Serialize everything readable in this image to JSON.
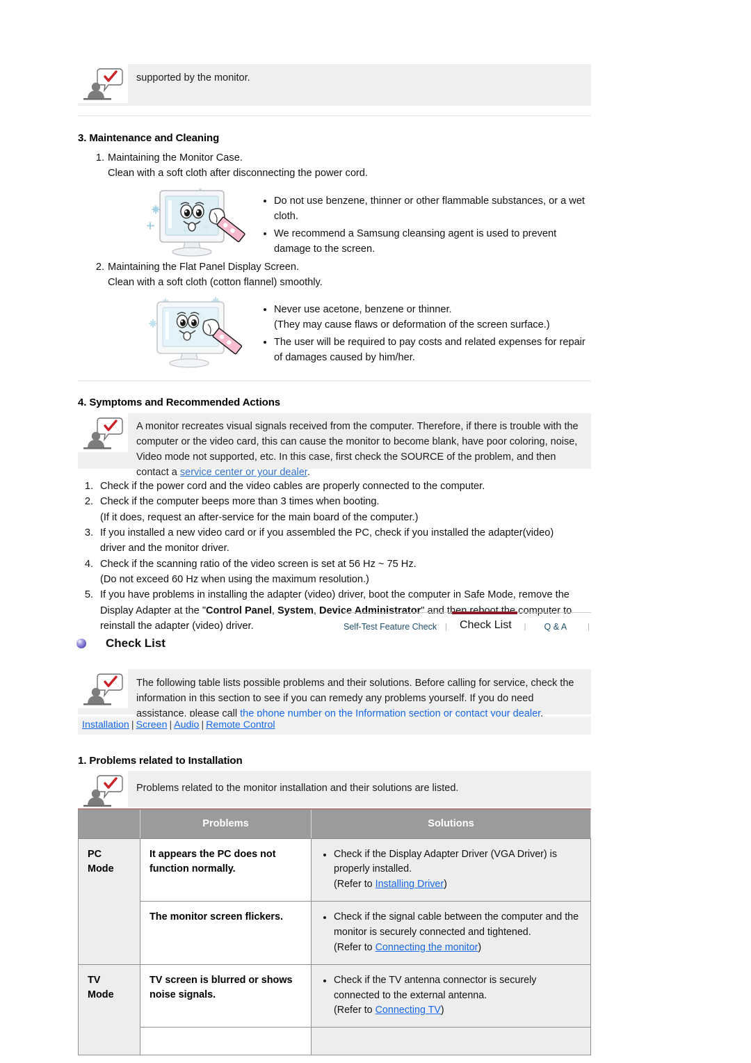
{
  "top_note": {
    "icon": "person-speech-check-icon",
    "text": "supported by the monitor."
  },
  "section3": {
    "heading": "3. Maintenance and Cleaning",
    "items": [
      {
        "num": "1.",
        "line1": "Maintaining the Monitor Case.",
        "line2": "Clean with a soft cloth after disconnecting the power cord."
      },
      {
        "num": "2.",
        "line1": "Maintaining the Flat Panel Display Screen.",
        "line2": "Clean with a soft cloth (cotton flannel) smoothly."
      }
    ],
    "figure1_alt": "cartoon-monitor-being-cleaned-with-cloth",
    "figure2_alt": "cartoon-monitor-being-cleaned-with-cloth",
    "bullets1": [
      "Do not use benzene, thinner or other flammable substances, or a wet cloth.",
      "We recommend a Samsung cleansing agent is used to prevent damage to the screen."
    ],
    "bullets2_line1a": "Never use acetone, benzene or thinner.",
    "bullets2_line1b": "(They may cause flaws or deformation of the screen surface.)",
    "bullets2_line2": "The user will be required to pay costs and related expenses for repair of damages caused by him/her."
  },
  "section4": {
    "heading": "4. Symptoms and Recommended Actions",
    "note_text_1": "A monitor recreates visual signals received from the computer. Therefore, if there is trouble with the computer or the video card, this can cause the monitor to become blank, have poor coloring, noise, Video mode not supported, etc. In this case, first check the SOURCE of the problem, and then contact a ",
    "note_link": "service center or your dealer",
    "note_text_2": ".",
    "steps": [
      {
        "num": "1.",
        "lines": [
          "Check if the power cord and the video cables are properly connected to the computer."
        ]
      },
      {
        "num": "2.",
        "lines": [
          "Check if the computer beeps more than 3 times when booting.",
          "(If it does, request an after-service for the main board of the computer.)"
        ]
      },
      {
        "num": "3.",
        "lines": [
          "If you installed a new video card or if you assembled the PC, check if you installed the adapter(video)",
          "driver and the monitor driver."
        ]
      },
      {
        "num": "4.",
        "lines": [
          "Check if the scanning ratio of the video screen is set at 56 Hz ~ 75 Hz.",
          "(Do not exceed 60 Hz when using the maximum resolution.)"
        ]
      }
    ],
    "step5": {
      "num": "5.",
      "part1": "If you have problems in installing the adapter (video) driver, boot the computer in Safe Mode, remove the Display Adapter at the \"",
      "bold1": "Control Panel",
      "mid1": ", ",
      "bold2": "System",
      "mid2": ", ",
      "bold3": "Device Administrator",
      "part2": "\" and then reboot the computer to reinstall the adapter (video) driver."
    }
  },
  "nav": {
    "tabs": [
      {
        "label": "Self-Test Feature Check",
        "active": false
      },
      {
        "label": "Check List",
        "active": true
      },
      {
        "label": "Q & A",
        "active": false
      }
    ],
    "separator": "|"
  },
  "checklist": {
    "title": "Check List",
    "bullet_icon": "purple-sphere-bullet-icon",
    "note_text_1": "The following table lists possible problems and their solutions. Before calling for service, check the information in this section to see if you can remedy any problems yourself. If you do need assistance, please call ",
    "note_link": "the phone number on the Information section or contact your dealer",
    "note_text_2": ".",
    "crumbs": [
      "Installation",
      "Screen",
      "Audio",
      "Remote Control"
    ],
    "crumb_divider": "|"
  },
  "installation": {
    "heading": "1. Problems related to Installation",
    "note": "Problems related to the monitor installation and their solutions are listed.",
    "table": {
      "headers": [
        "",
        "Problems",
        "Solutions"
      ],
      "rows": [
        {
          "mode": "PC\nMode",
          "mode_line1": "PC",
          "mode_line2": "Mode",
          "problem": "It appears the PC does not function normally.",
          "solution_main": "Check if the Display Adapter Driver (VGA Driver) is properly installed.",
          "solution_refer_pre": "(Refer to ",
          "solution_refer_link": "Installing Driver",
          "solution_refer_post": ")"
        },
        {
          "mode_line1": "",
          "mode_line2": "",
          "problem": "The monitor screen flickers.",
          "solution_main": "Check if the signal cable between the computer and the monitor is securely connected and tightened.",
          "solution_refer_pre": "(Refer to ",
          "solution_refer_link": "Connecting the monitor",
          "solution_refer_post": ")"
        },
        {
          "mode_line1": "TV",
          "mode_line2": "Mode",
          "problem": "TV screen is blurred or shows noise signals.",
          "solution_main": "Check if the TV antenna connector is securely connected to the external antenna.",
          "solution_refer_pre": "(Refer to ",
          "solution_refer_link": "Connecting TV",
          "solution_refer_post": ")"
        },
        {
          "mode_line1": "",
          "mode_line2": "",
          "problem": "",
          "solution_main": "",
          "solution_refer_pre": "",
          "solution_refer_link": "",
          "solution_refer_post": ""
        }
      ]
    }
  },
  "colors": {
    "link": "#1667e8",
    "link_dark": "#2f6fd0",
    "accent_red": "#8d1724",
    "table_header_bg": "#9b9b9b",
    "infobox_bg": "#efefef",
    "row_alt_bg": "#ededed"
  }
}
